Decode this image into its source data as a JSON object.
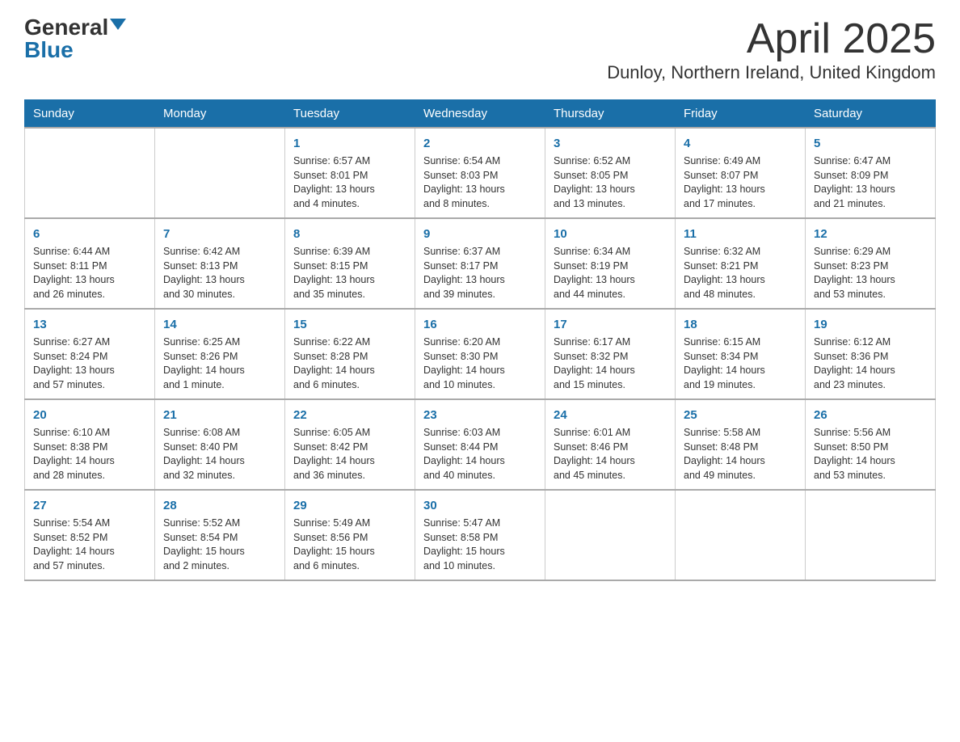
{
  "header": {
    "logo_general": "General",
    "logo_blue": "Blue",
    "month_title": "April 2025",
    "location": "Dunloy, Northern Ireland, United Kingdom"
  },
  "calendar": {
    "days_of_week": [
      "Sunday",
      "Monday",
      "Tuesday",
      "Wednesday",
      "Thursday",
      "Friday",
      "Saturday"
    ],
    "weeks": [
      [
        {
          "day": "",
          "info": ""
        },
        {
          "day": "",
          "info": ""
        },
        {
          "day": "1",
          "info": "Sunrise: 6:57 AM\nSunset: 8:01 PM\nDaylight: 13 hours\nand 4 minutes."
        },
        {
          "day": "2",
          "info": "Sunrise: 6:54 AM\nSunset: 8:03 PM\nDaylight: 13 hours\nand 8 minutes."
        },
        {
          "day": "3",
          "info": "Sunrise: 6:52 AM\nSunset: 8:05 PM\nDaylight: 13 hours\nand 13 minutes."
        },
        {
          "day": "4",
          "info": "Sunrise: 6:49 AM\nSunset: 8:07 PM\nDaylight: 13 hours\nand 17 minutes."
        },
        {
          "day": "5",
          "info": "Sunrise: 6:47 AM\nSunset: 8:09 PM\nDaylight: 13 hours\nand 21 minutes."
        }
      ],
      [
        {
          "day": "6",
          "info": "Sunrise: 6:44 AM\nSunset: 8:11 PM\nDaylight: 13 hours\nand 26 minutes."
        },
        {
          "day": "7",
          "info": "Sunrise: 6:42 AM\nSunset: 8:13 PM\nDaylight: 13 hours\nand 30 minutes."
        },
        {
          "day": "8",
          "info": "Sunrise: 6:39 AM\nSunset: 8:15 PM\nDaylight: 13 hours\nand 35 minutes."
        },
        {
          "day": "9",
          "info": "Sunrise: 6:37 AM\nSunset: 8:17 PM\nDaylight: 13 hours\nand 39 minutes."
        },
        {
          "day": "10",
          "info": "Sunrise: 6:34 AM\nSunset: 8:19 PM\nDaylight: 13 hours\nand 44 minutes."
        },
        {
          "day": "11",
          "info": "Sunrise: 6:32 AM\nSunset: 8:21 PM\nDaylight: 13 hours\nand 48 minutes."
        },
        {
          "day": "12",
          "info": "Sunrise: 6:29 AM\nSunset: 8:23 PM\nDaylight: 13 hours\nand 53 minutes."
        }
      ],
      [
        {
          "day": "13",
          "info": "Sunrise: 6:27 AM\nSunset: 8:24 PM\nDaylight: 13 hours\nand 57 minutes."
        },
        {
          "day": "14",
          "info": "Sunrise: 6:25 AM\nSunset: 8:26 PM\nDaylight: 14 hours\nand 1 minute."
        },
        {
          "day": "15",
          "info": "Sunrise: 6:22 AM\nSunset: 8:28 PM\nDaylight: 14 hours\nand 6 minutes."
        },
        {
          "day": "16",
          "info": "Sunrise: 6:20 AM\nSunset: 8:30 PM\nDaylight: 14 hours\nand 10 minutes."
        },
        {
          "day": "17",
          "info": "Sunrise: 6:17 AM\nSunset: 8:32 PM\nDaylight: 14 hours\nand 15 minutes."
        },
        {
          "day": "18",
          "info": "Sunrise: 6:15 AM\nSunset: 8:34 PM\nDaylight: 14 hours\nand 19 minutes."
        },
        {
          "day": "19",
          "info": "Sunrise: 6:12 AM\nSunset: 8:36 PM\nDaylight: 14 hours\nand 23 minutes."
        }
      ],
      [
        {
          "day": "20",
          "info": "Sunrise: 6:10 AM\nSunset: 8:38 PM\nDaylight: 14 hours\nand 28 minutes."
        },
        {
          "day": "21",
          "info": "Sunrise: 6:08 AM\nSunset: 8:40 PM\nDaylight: 14 hours\nand 32 minutes."
        },
        {
          "day": "22",
          "info": "Sunrise: 6:05 AM\nSunset: 8:42 PM\nDaylight: 14 hours\nand 36 minutes."
        },
        {
          "day": "23",
          "info": "Sunrise: 6:03 AM\nSunset: 8:44 PM\nDaylight: 14 hours\nand 40 minutes."
        },
        {
          "day": "24",
          "info": "Sunrise: 6:01 AM\nSunset: 8:46 PM\nDaylight: 14 hours\nand 45 minutes."
        },
        {
          "day": "25",
          "info": "Sunrise: 5:58 AM\nSunset: 8:48 PM\nDaylight: 14 hours\nand 49 minutes."
        },
        {
          "day": "26",
          "info": "Sunrise: 5:56 AM\nSunset: 8:50 PM\nDaylight: 14 hours\nand 53 minutes."
        }
      ],
      [
        {
          "day": "27",
          "info": "Sunrise: 5:54 AM\nSunset: 8:52 PM\nDaylight: 14 hours\nand 57 minutes."
        },
        {
          "day": "28",
          "info": "Sunrise: 5:52 AM\nSunset: 8:54 PM\nDaylight: 15 hours\nand 2 minutes."
        },
        {
          "day": "29",
          "info": "Sunrise: 5:49 AM\nSunset: 8:56 PM\nDaylight: 15 hours\nand 6 minutes."
        },
        {
          "day": "30",
          "info": "Sunrise: 5:47 AM\nSunset: 8:58 PM\nDaylight: 15 hours\nand 10 minutes."
        },
        {
          "day": "",
          "info": ""
        },
        {
          "day": "",
          "info": ""
        },
        {
          "day": "",
          "info": ""
        }
      ]
    ]
  }
}
